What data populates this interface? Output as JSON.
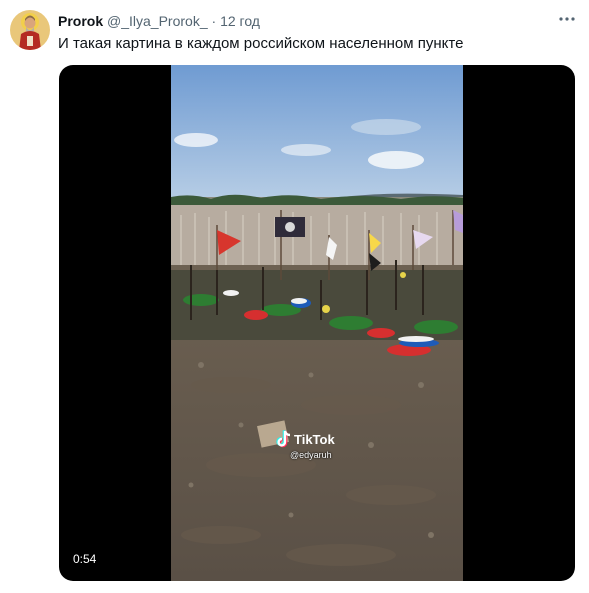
{
  "tweet": {
    "display_name": "Prorok",
    "handle": "@_Ilya_Prorok_",
    "separator": "·",
    "time": "12 год",
    "more_icon": "more-horizontal-icon",
    "text": "И такая картина в каждом российском населенном пункте"
  },
  "media": {
    "duration": "0:54",
    "watermark_brand": "TikTok",
    "watermark_user": "@edyaruh"
  },
  "colors": {
    "text_primary": "#0f1419",
    "text_secondary": "#536471",
    "media_background": "#000000"
  }
}
